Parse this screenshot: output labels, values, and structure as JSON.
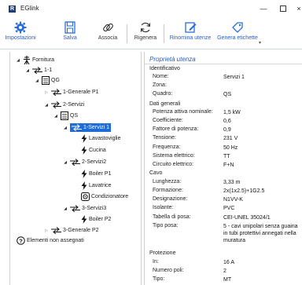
{
  "window": {
    "title": "EGlink",
    "app_icon_letter": "R",
    "minimize_glyph": "—",
    "close_glyph": "×"
  },
  "ribbon": {
    "impostazioni": "Impostazioni",
    "salva": "Salva",
    "associa": "Associa",
    "rigenera": "Rigenera",
    "rinomina": "Rinomina utenze",
    "genera": "Genera etichette",
    "more_glyph": "▾"
  },
  "tree": {
    "fornitura": "Fornitura",
    "n1_1": "1-1",
    "qg": "QG",
    "generale_p1": "1-Generale P1",
    "servizi_2": "2-Servizi",
    "qs": "QS",
    "servizi_1": "1-Servizi 1",
    "lavastoviglie": "Lavastoviglie",
    "cucina": "Cucina",
    "servizi2": "2-Servizi2",
    "boiler_p1": "Boiler P1",
    "lavatrice": "Lavatrice",
    "condizionatore": "Condizionatore",
    "servizi3": "3-Servizi3",
    "boiler_p2": "Boiler P2",
    "generale_p2": "3-Generale P2",
    "non_assegnati": "Elementi non assegnati"
  },
  "props": {
    "title": "Proprietà utenza",
    "identificativo": "Identificativo",
    "nome_l": "Nome:",
    "nome_v": "Servizi 1",
    "zona_l": "Zona:",
    "zona_v": "",
    "quadro_l": "Quadro:",
    "quadro_v": "QS",
    "dati_generali": "Dati generali",
    "potenza_l": "Potenza attiva nominale:",
    "potenza_v": "1,5 kW",
    "coeff_l": "Coefficiente:",
    "coeff_v": "0,6",
    "fattore_l": "Fattore di potenza:",
    "fattore_v": "0,9",
    "tensione_l": "Tensione:",
    "tensione_v": "231 V",
    "frequenza_l": "Frequenza:",
    "frequenza_v": "50 Hz",
    "sistema_l": "Sistema elettrico:",
    "sistema_v": "TT",
    "circuito_l": "Circuito elettrico:",
    "circuito_v": "F+N",
    "cavo": "Cavo",
    "lunghezza_l": "Lunghezza:",
    "lunghezza_v": "3,33 m",
    "formazione_l": "Formazione:",
    "formazione_v": "2x(1x2.5)+1G2.5",
    "designazione_l": "Designazione:",
    "designazione_v": "N1VV-K",
    "isolante_l": "Isolante:",
    "isolante_v": "PVC",
    "tabella_l": "Tabella di posa:",
    "tabella_v": "CEI-UNEL 35024/1",
    "tipoposa_l": "Tipo posa:",
    "tipoposa_v": "5 - cavi unipolari senza guaina in tubi protettivi annegati nella muratura",
    "protezione": "Protezione",
    "in_l": "In:",
    "in_v": "16 A",
    "poli_l": "Numero poli:",
    "poli_v": "2",
    "tipo_l": "Tipo:",
    "tipo_v": "MT"
  },
  "colors": {
    "accent": "#2b5cb8",
    "selection": "#1e6cd8",
    "icon_dark": "#1c3d78"
  }
}
